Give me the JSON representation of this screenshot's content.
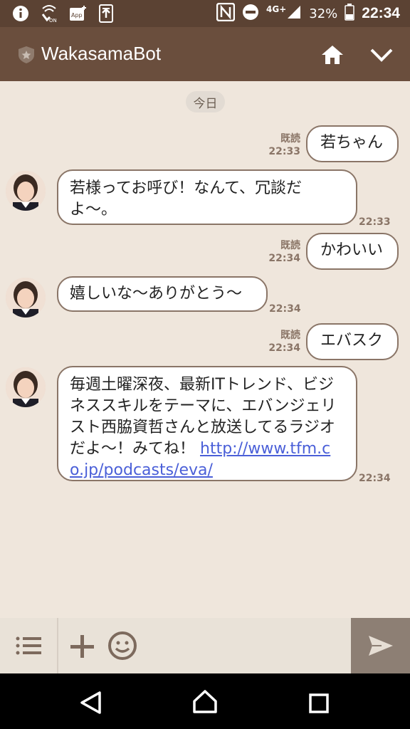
{
  "status_bar": {
    "icons_left": [
      "info-icon",
      "wifi-calling-icon",
      "app-update-icon",
      "upload-icon"
    ],
    "icons_right": [
      "nfc-icon",
      "do-not-disturb-icon",
      "signal-icon",
      "battery-icon"
    ],
    "network": "4G+",
    "battery": "32%",
    "time": "22:34"
  },
  "header": {
    "title": "WakasamaBot",
    "icons": [
      "shield-star-icon",
      "home-icon",
      "chevron-down-icon"
    ]
  },
  "chat": {
    "date_label": "今日",
    "messages": [
      {
        "side": "right",
        "read": "既読",
        "time": "22:33",
        "text": "若ちゃん"
      },
      {
        "side": "left",
        "text": "若様ってお呼び！なんて、冗談だよ〜。",
        "time": "22:33"
      },
      {
        "side": "right",
        "read": "既読",
        "time": "22:34",
        "text": "かわいい"
      },
      {
        "side": "left",
        "text": "嬉しいな〜ありがとう〜",
        "time": "22:34"
      },
      {
        "side": "right",
        "read": "既読",
        "time": "22:34",
        "text": "エバスク"
      },
      {
        "side": "left",
        "text": "毎週土曜深夜、最新ITトレンド、ビジネススキルをテーマに、エバンジェリスト西脇資哲さんと放送してるラジオだよ〜！みてね！",
        "link": "http://www.tfm.co.jp/podcasts/eva/",
        "time": "22:34"
      }
    ]
  },
  "input_bar": {
    "icons": [
      "menu-list-icon",
      "plus-icon",
      "emoji-icon",
      "send-icon"
    ]
  },
  "nav_bar": {
    "icons": [
      "back-icon",
      "home-nav-icon",
      "recents-icon"
    ]
  }
}
